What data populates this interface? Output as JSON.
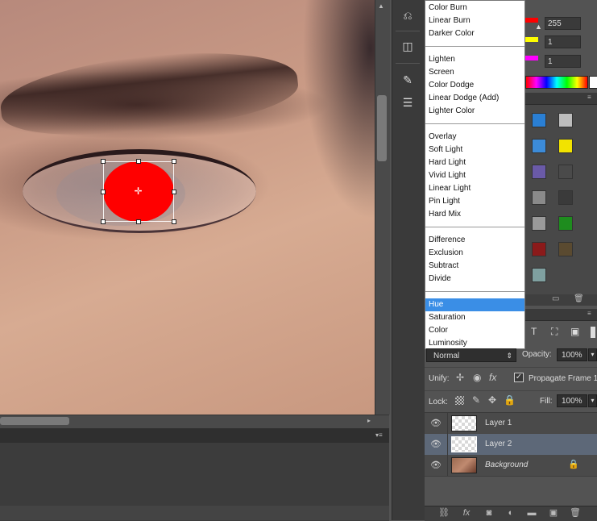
{
  "blend_menu": {
    "groups": [
      [
        "Color Burn",
        "Linear Burn",
        "Darker Color"
      ],
      [
        "Lighten",
        "Screen",
        "Color Dodge",
        "Linear Dodge (Add)",
        "Lighter Color"
      ],
      [
        "Overlay",
        "Soft Light",
        "Hard Light",
        "Vivid Light",
        "Linear Light",
        "Pin Light",
        "Hard Mix"
      ],
      [
        "Difference",
        "Exclusion",
        "Subtract",
        "Divide"
      ],
      [
        "Hue",
        "Saturation",
        "Color",
        "Luminosity"
      ]
    ],
    "selected": "Hue"
  },
  "color_panel": {
    "values": [
      "255",
      "1",
      "1"
    ],
    "slider_colors": [
      "#ff0000",
      "#ffff00",
      "#ff00ff"
    ]
  },
  "layers_panel": {
    "blend_mode": "Normal",
    "opacity_label": "Opacity:",
    "opacity_value": "100%",
    "unify_label": "Unify:",
    "propagate_label": "Propagate Frame 1",
    "lock_label": "Lock:",
    "fill_label": "Fill:",
    "fill_value": "100%",
    "layers": [
      {
        "name": "Layer 1",
        "selected": false,
        "type": "transparent"
      },
      {
        "name": "Layer 2",
        "selected": true,
        "type": "transparent"
      },
      {
        "name": "Background",
        "selected": false,
        "type": "image",
        "locked": true
      }
    ]
  },
  "swatches": [
    "#2a7fd4",
    "#bdbdbd",
    "#3c8bd8",
    "#f2e300",
    "#6a5aa8",
    "#4a4a4a",
    "#8a8a8a",
    "#3a3a3a",
    "#9a9a9a",
    "#1e8c1e",
    "#8b1a1a",
    "#5a4a30",
    "#7fa0a0"
  ],
  "accent_red": "#ff0000",
  "icons": [
    "brush-preset-icon",
    "3d-icon",
    "paths-icon",
    "adjust-icon",
    "visibility-eye-icon",
    "lock-icon",
    "link-icon",
    "fx-icon",
    "mask-icon",
    "adjustment-layer-icon",
    "folder-icon",
    "new-layer-icon",
    "trash-icon"
  ]
}
